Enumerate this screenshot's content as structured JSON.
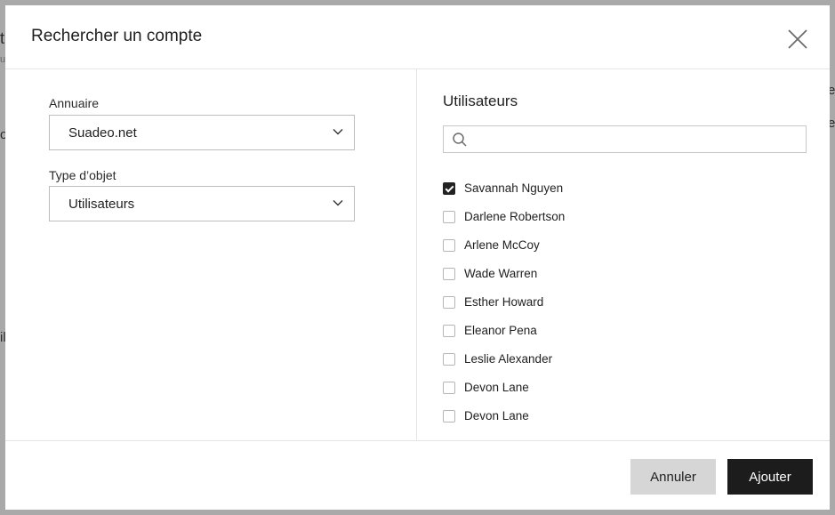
{
  "background": {
    "fragments": [
      "ti",
      "u",
      "o",
      "il",
      "e",
      "e"
    ]
  },
  "dialog": {
    "title": "Rechercher un compte",
    "close_icon": "close-icon"
  },
  "form": {
    "directory": {
      "label": "Annuaire",
      "value": "Suadeo.net"
    },
    "object_type": {
      "label": "Type d’objet",
      "value": "Utilisateurs"
    }
  },
  "users_panel": {
    "title": "Utilisateurs",
    "search": {
      "placeholder": "",
      "value": "",
      "icon": "search-icon"
    },
    "users": [
      {
        "name": "Savannah Nguyen",
        "checked": true
      },
      {
        "name": "Darlene Robertson",
        "checked": false
      },
      {
        "name": "Arlene McCoy",
        "checked": false
      },
      {
        "name": "Wade Warren",
        "checked": false
      },
      {
        "name": "Esther Howard",
        "checked": false
      },
      {
        "name": "Eleanor Pena",
        "checked": false
      },
      {
        "name": "Leslie Alexander",
        "checked": false
      },
      {
        "name": "Devon Lane",
        "checked": false
      },
      {
        "name": "Devon Lane",
        "checked": false
      }
    ]
  },
  "footer": {
    "cancel_label": "Annuler",
    "add_label": "Ajouter"
  },
  "colors": {
    "overlay": "#a9a9a9",
    "primary_button": "#1c1c1c",
    "secondary_button": "#d6d6d6"
  }
}
